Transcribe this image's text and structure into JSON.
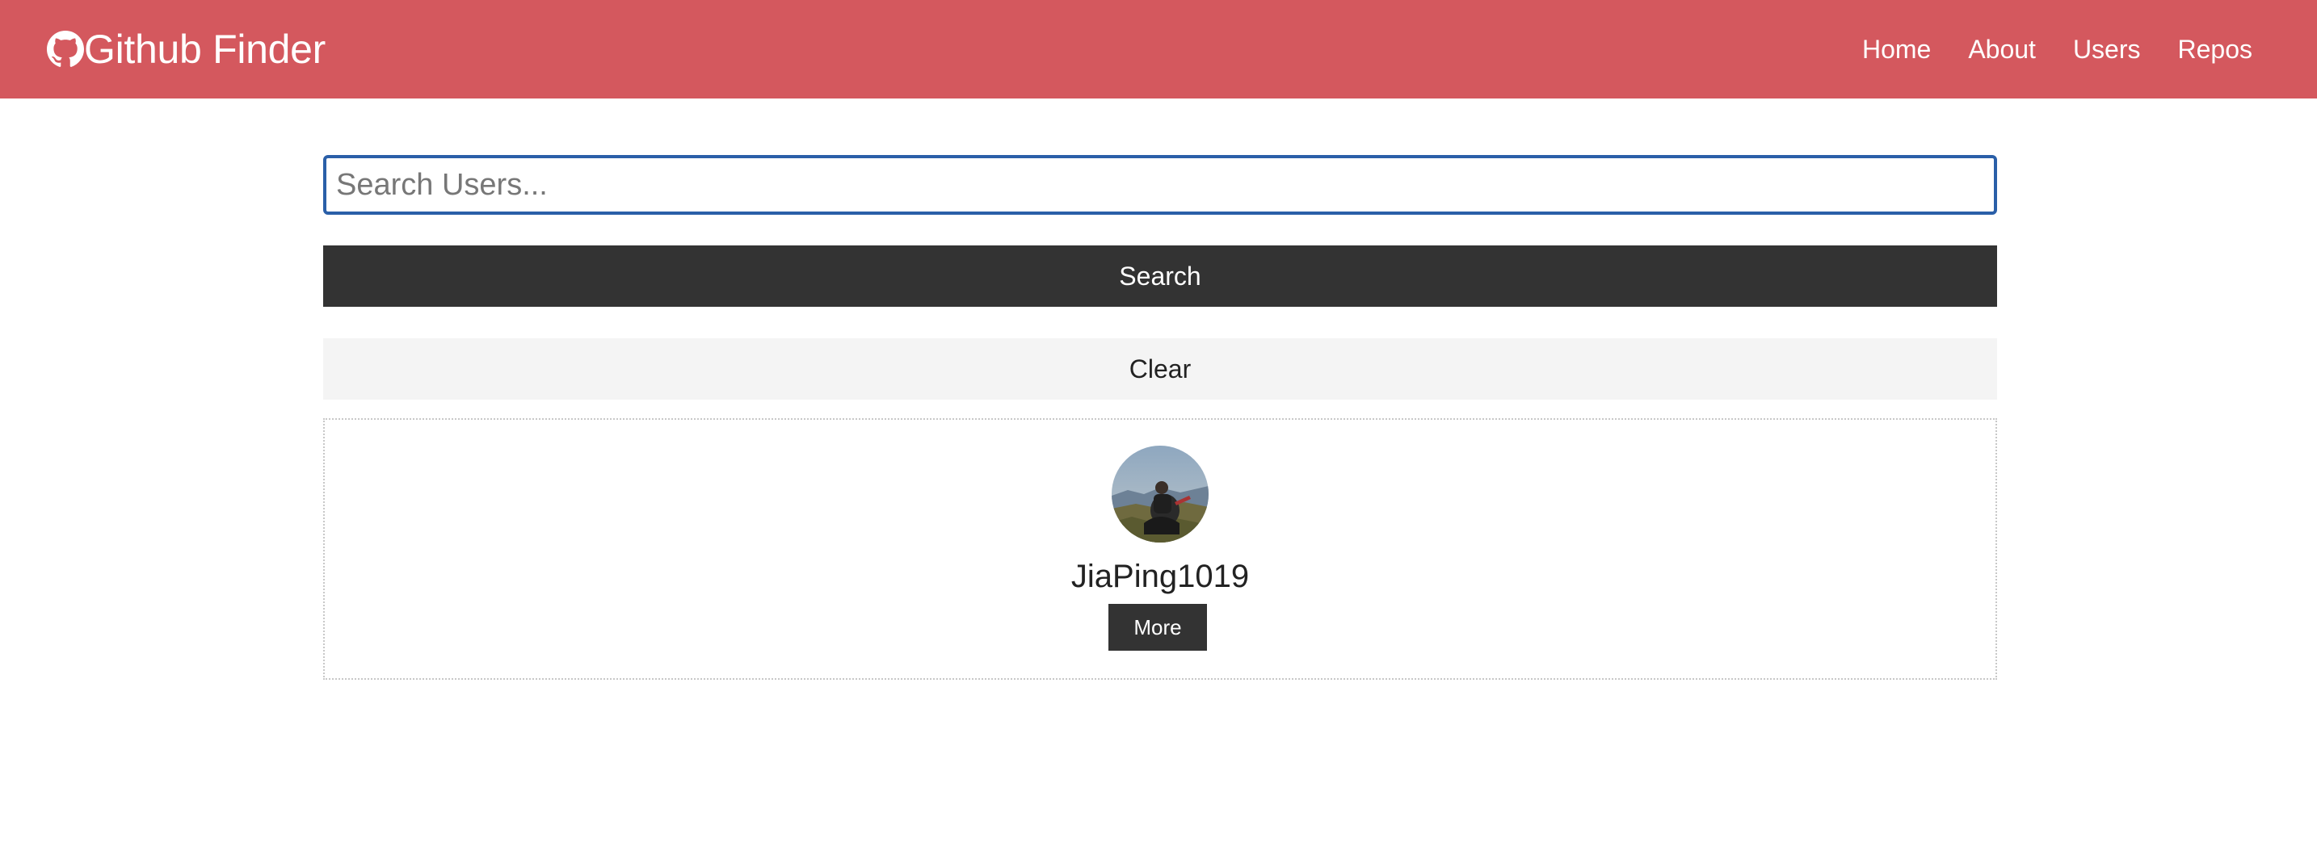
{
  "navbar": {
    "brand": {
      "icon": "github-icon",
      "title": "Github Finder"
    },
    "links": [
      {
        "label": "Home"
      },
      {
        "label": "About"
      },
      {
        "label": "Users"
      },
      {
        "label": "Repos"
      }
    ]
  },
  "search": {
    "placeholder": "Search Users...",
    "value": "",
    "submit_label": "Search",
    "clear_label": "Clear"
  },
  "results": [
    {
      "avatar": "user-avatar-photo",
      "login": "JiaPing1019",
      "more_label": "More"
    }
  ],
  "colors": {
    "navbar_bg": "#d4585e",
    "dark_button": "#333333",
    "light_button": "#f4f4f4",
    "input_focus_border": "#2a5fa8"
  }
}
